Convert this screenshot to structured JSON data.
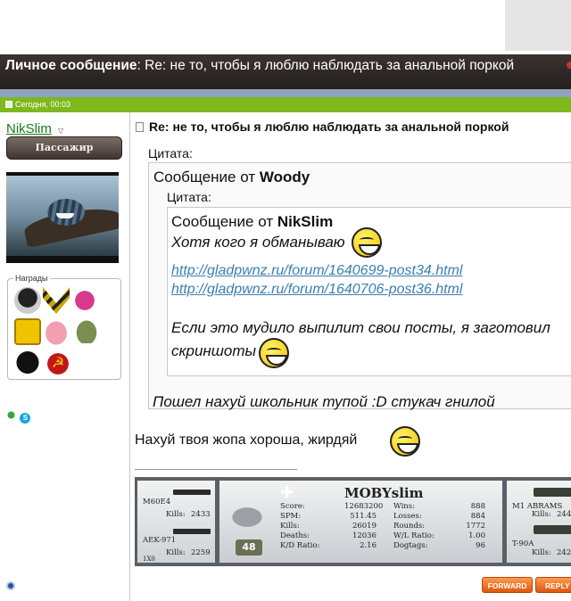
{
  "title_bar": {
    "prefix": "Личное сообщение",
    "separator": ":",
    "subject": " Re: не то, чтобы я люблю наблюдать за анальной поркой"
  },
  "date_bar": {
    "text": "Сегодня, 00:03"
  },
  "sender": {
    "username": "NikSlim",
    "rank": "Пассажир",
    "awards_label": "Награды",
    "awards": [
      "spy-award",
      "chevron-award",
      "adidas-award",
      "medal-award",
      "pig-award",
      "tanks-award",
      "vader-award",
      "hammer-sickle-award"
    ]
  },
  "post": {
    "title": "Re: не то, чтобы я люблю наблюдать за анальной поркой",
    "outer_quote": {
      "label": "Цитата:",
      "from_prefix": "Сообщение от ",
      "author": "Woody",
      "tail": "Пошел нахуй школьник тупой :D стукач гнилой"
    },
    "inner_quote": {
      "label": "Цитата:",
      "from_prefix": "Сообщение от ",
      "author": "NikSlim",
      "line1": "Хотя кого я обманываю",
      "link1": "http://gladpwnz.ru/forum/1640699-post34.html",
      "link2": "http://gladpwnz.ru/forum/1640706-post36.html",
      "line2": "Если это мудило выпилит свои посты, я заготовил скриншоты"
    },
    "reply": "Нахуй твоя жопа хороша, жирдяй"
  },
  "signature": {
    "player": "MOBYslim",
    "left": {
      "weapon1": "M60E4",
      "kills1_label": "Kills:",
      "kills1": "2433",
      "weapon2": "AEK-971",
      "kills2_label": "Kills:",
      "kills2": "2259",
      "footer": "1X0"
    },
    "level": "48",
    "stats_left": [
      {
        "label": "Score:",
        "value": "12683200"
      },
      {
        "label": "SPM:",
        "value": "511.45"
      },
      {
        "label": "Kills:",
        "value": "26019"
      },
      {
        "label": "Deaths:",
        "value": "12036"
      },
      {
        "label": "K/D Ratio:",
        "value": "2.16"
      }
    ],
    "stats_right": [
      {
        "label": "Wins:",
        "value": "888"
      },
      {
        "label": "Losses:",
        "value": "884"
      },
      {
        "label": "Rounds:",
        "value": "1772"
      },
      {
        "label": "W/L Ratio:",
        "value": "1.00"
      },
      {
        "label": "Dogtags:",
        "value": "96"
      }
    ],
    "right": {
      "vehicle1": "M1 ABRAMS",
      "kills1_label": "Kills:",
      "kills1": "244",
      "vehicle2": "T-90A",
      "kills2_label": "Kills:",
      "kills2": "242"
    }
  },
  "buttons": {
    "forward": "FORWARD",
    "reply": "REPLY"
  }
}
